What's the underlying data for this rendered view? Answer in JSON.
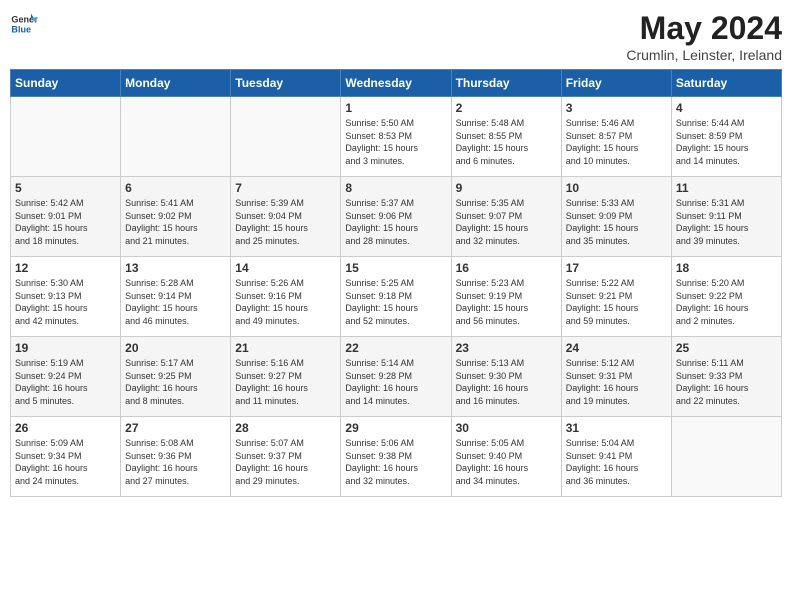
{
  "logo": {
    "general": "General",
    "blue": "Blue"
  },
  "title": {
    "month": "May 2024",
    "location": "Crumlin, Leinster, Ireland"
  },
  "headers": [
    "Sunday",
    "Monday",
    "Tuesday",
    "Wednesday",
    "Thursday",
    "Friday",
    "Saturday"
  ],
  "weeks": [
    [
      {
        "num": "",
        "info": ""
      },
      {
        "num": "",
        "info": ""
      },
      {
        "num": "",
        "info": ""
      },
      {
        "num": "1",
        "info": "Sunrise: 5:50 AM\nSunset: 8:53 PM\nDaylight: 15 hours\nand 3 minutes."
      },
      {
        "num": "2",
        "info": "Sunrise: 5:48 AM\nSunset: 8:55 PM\nDaylight: 15 hours\nand 6 minutes."
      },
      {
        "num": "3",
        "info": "Sunrise: 5:46 AM\nSunset: 8:57 PM\nDaylight: 15 hours\nand 10 minutes."
      },
      {
        "num": "4",
        "info": "Sunrise: 5:44 AM\nSunset: 8:59 PM\nDaylight: 15 hours\nand 14 minutes."
      }
    ],
    [
      {
        "num": "5",
        "info": "Sunrise: 5:42 AM\nSunset: 9:01 PM\nDaylight: 15 hours\nand 18 minutes."
      },
      {
        "num": "6",
        "info": "Sunrise: 5:41 AM\nSunset: 9:02 PM\nDaylight: 15 hours\nand 21 minutes."
      },
      {
        "num": "7",
        "info": "Sunrise: 5:39 AM\nSunset: 9:04 PM\nDaylight: 15 hours\nand 25 minutes."
      },
      {
        "num": "8",
        "info": "Sunrise: 5:37 AM\nSunset: 9:06 PM\nDaylight: 15 hours\nand 28 minutes."
      },
      {
        "num": "9",
        "info": "Sunrise: 5:35 AM\nSunset: 9:07 PM\nDaylight: 15 hours\nand 32 minutes."
      },
      {
        "num": "10",
        "info": "Sunrise: 5:33 AM\nSunset: 9:09 PM\nDaylight: 15 hours\nand 35 minutes."
      },
      {
        "num": "11",
        "info": "Sunrise: 5:31 AM\nSunset: 9:11 PM\nDaylight: 15 hours\nand 39 minutes."
      }
    ],
    [
      {
        "num": "12",
        "info": "Sunrise: 5:30 AM\nSunset: 9:13 PM\nDaylight: 15 hours\nand 42 minutes."
      },
      {
        "num": "13",
        "info": "Sunrise: 5:28 AM\nSunset: 9:14 PM\nDaylight: 15 hours\nand 46 minutes."
      },
      {
        "num": "14",
        "info": "Sunrise: 5:26 AM\nSunset: 9:16 PM\nDaylight: 15 hours\nand 49 minutes."
      },
      {
        "num": "15",
        "info": "Sunrise: 5:25 AM\nSunset: 9:18 PM\nDaylight: 15 hours\nand 52 minutes."
      },
      {
        "num": "16",
        "info": "Sunrise: 5:23 AM\nSunset: 9:19 PM\nDaylight: 15 hours\nand 56 minutes."
      },
      {
        "num": "17",
        "info": "Sunrise: 5:22 AM\nSunset: 9:21 PM\nDaylight: 15 hours\nand 59 minutes."
      },
      {
        "num": "18",
        "info": "Sunrise: 5:20 AM\nSunset: 9:22 PM\nDaylight: 16 hours\nand 2 minutes."
      }
    ],
    [
      {
        "num": "19",
        "info": "Sunrise: 5:19 AM\nSunset: 9:24 PM\nDaylight: 16 hours\nand 5 minutes."
      },
      {
        "num": "20",
        "info": "Sunrise: 5:17 AM\nSunset: 9:25 PM\nDaylight: 16 hours\nand 8 minutes."
      },
      {
        "num": "21",
        "info": "Sunrise: 5:16 AM\nSunset: 9:27 PM\nDaylight: 16 hours\nand 11 minutes."
      },
      {
        "num": "22",
        "info": "Sunrise: 5:14 AM\nSunset: 9:28 PM\nDaylight: 16 hours\nand 14 minutes."
      },
      {
        "num": "23",
        "info": "Sunrise: 5:13 AM\nSunset: 9:30 PM\nDaylight: 16 hours\nand 16 minutes."
      },
      {
        "num": "24",
        "info": "Sunrise: 5:12 AM\nSunset: 9:31 PM\nDaylight: 16 hours\nand 19 minutes."
      },
      {
        "num": "25",
        "info": "Sunrise: 5:11 AM\nSunset: 9:33 PM\nDaylight: 16 hours\nand 22 minutes."
      }
    ],
    [
      {
        "num": "26",
        "info": "Sunrise: 5:09 AM\nSunset: 9:34 PM\nDaylight: 16 hours\nand 24 minutes."
      },
      {
        "num": "27",
        "info": "Sunrise: 5:08 AM\nSunset: 9:36 PM\nDaylight: 16 hours\nand 27 minutes."
      },
      {
        "num": "28",
        "info": "Sunrise: 5:07 AM\nSunset: 9:37 PM\nDaylight: 16 hours\nand 29 minutes."
      },
      {
        "num": "29",
        "info": "Sunrise: 5:06 AM\nSunset: 9:38 PM\nDaylight: 16 hours\nand 32 minutes."
      },
      {
        "num": "30",
        "info": "Sunrise: 5:05 AM\nSunset: 9:40 PM\nDaylight: 16 hours\nand 34 minutes."
      },
      {
        "num": "31",
        "info": "Sunrise: 5:04 AM\nSunset: 9:41 PM\nDaylight: 16 hours\nand 36 minutes."
      },
      {
        "num": "",
        "info": ""
      }
    ]
  ]
}
